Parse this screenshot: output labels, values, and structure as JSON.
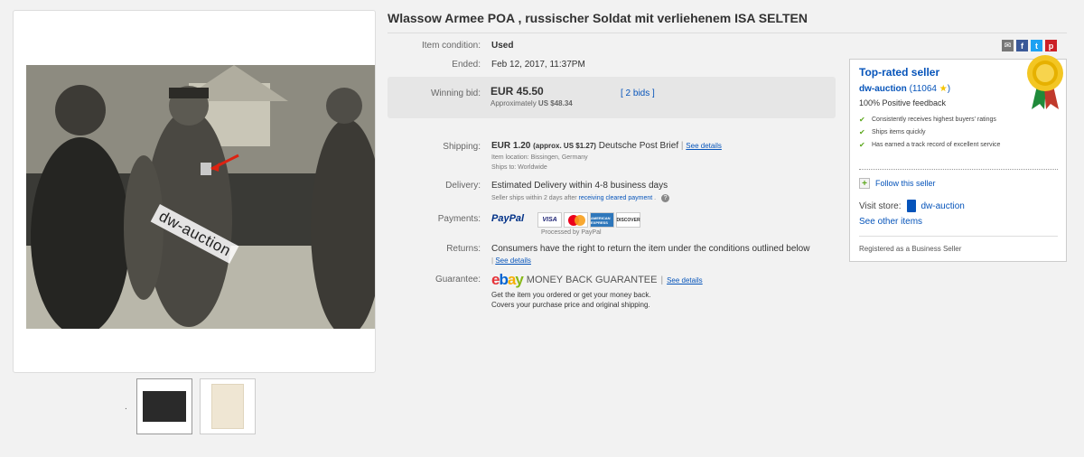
{
  "listing": {
    "title": "Wlassow Armee POA , russischer Soldat mit verliehenem ISA SELTEN",
    "watermark": "dw-auction",
    "thumb_dot": "."
  },
  "details": {
    "condition_label": "Item condition:",
    "condition_value": "Used",
    "ended_label": "Ended:",
    "ended_value": "Feb 12, 2017, 11:37PM",
    "bid_label": "Winning bid:",
    "bid_value": "EUR 45.50",
    "bid_approx_prefix": "Approximately",
    "bid_approx_value": "US $48.34",
    "bids_link": "[ 2 bids ]",
    "shipping_label": "Shipping:",
    "shipping_cost": "EUR 1.20",
    "shipping_approx": "(approx. US $1.27)",
    "shipping_method": "Deutsche Post Brief",
    "shipping_see_details": "See details",
    "item_location": "Item location:  Bissingen, Germany",
    "ships_to": "Ships to:  Worldwide",
    "delivery_label": "Delivery:",
    "delivery_value": "Estimated Delivery within 4-8 business days",
    "delivery_note": "Seller ships within 2 days after",
    "delivery_note_link": "receiving cleared payment",
    "delivery_note_tail": ".",
    "delivery_help": "?",
    "payments_label": "Payments:",
    "paypal_pay": "PayPal",
    "paypal_pal": "",
    "processed_by": "Processed by PayPal",
    "returns_label": "Returns:",
    "returns_value": "Consumers have the right to return the item under the conditions outlined below",
    "returns_see_details": "See details",
    "guarantee_label": "Guarantee:",
    "mbg_text": "MONEY BACK GUARANTEE",
    "guarantee_see_details": "See details",
    "guarantee_line1": "Get the item you ordered or get your money back.",
    "guarantee_line2": "Covers your purchase price and original shipping."
  },
  "cards": [
    "VISA",
    "MasterCard",
    "AMERICAN EXPRESS",
    "DISCOVER"
  ],
  "seller": {
    "badge_title": "Top-rated seller",
    "name": "dw-auction",
    "feedback_count": "11064",
    "positive": "100% Positive feedback",
    "perks": [
      "Consistently receives highest buyers' ratings",
      "Ships items quickly",
      "Has earned a track record of excellent service"
    ],
    "follow": "Follow this seller",
    "visit_store_label": "Visit store:",
    "store_name": "dw-auction",
    "see_other": "See other items",
    "registered": "Registered as a Business Seller"
  },
  "colors": {
    "link": "#0654ba",
    "star": "#f5c400",
    "check": "#5ba71b"
  }
}
